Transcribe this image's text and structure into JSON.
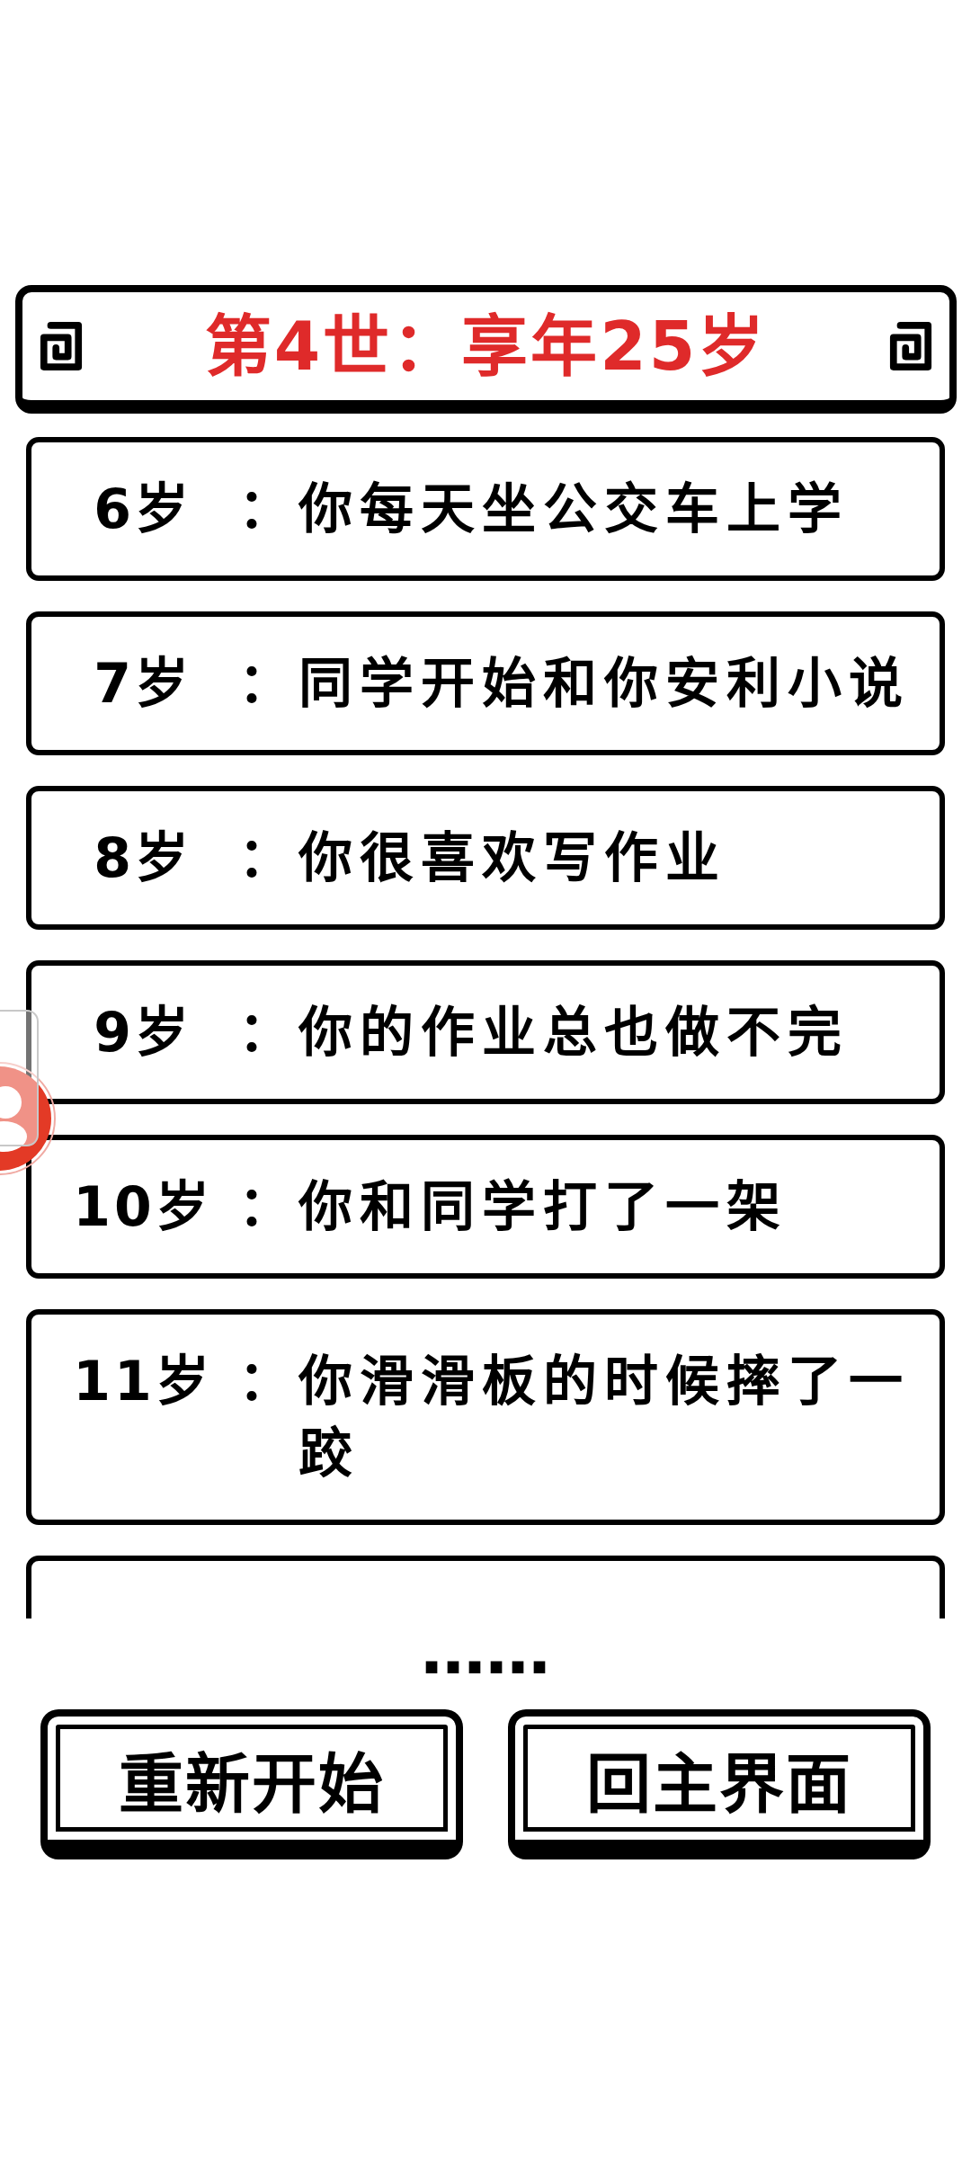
{
  "title": {
    "text": "第4世：享年25岁"
  },
  "events": [
    {
      "age": "6岁",
      "separator": "：",
      "text": "你每天坐公交车上学"
    },
    {
      "age": "7岁",
      "separator": "：",
      "text": "同学开始和你安利小说"
    },
    {
      "age": "8岁",
      "separator": "：",
      "text": "你很喜欢写作业"
    },
    {
      "age": "9岁",
      "separator": "：",
      "text": "你的作业总也做不完"
    },
    {
      "age": "10岁",
      "separator": "：",
      "text": "你和同学打了一架"
    },
    {
      "age": "11岁",
      "separator": "：",
      "text": "你滑滑板的时候摔了一跤"
    }
  ],
  "more_events_below": true,
  "ellipsis": "……",
  "buttons": [
    {
      "label": "重新开始"
    },
    {
      "label": "回主界面"
    }
  ]
}
